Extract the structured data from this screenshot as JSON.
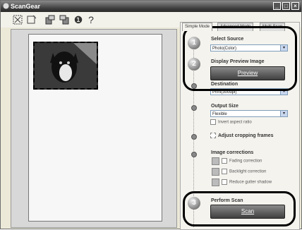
{
  "window": {
    "title": "ScanGear",
    "minimize": "_",
    "maximize": "□",
    "close": "×"
  },
  "toolbar": {
    "info_glyph": "❶",
    "help_glyph": "?"
  },
  "tabs": [
    "Simple Mode",
    "Advanced Mode",
    "Multi-Scan"
  ],
  "steps": {
    "s1": {
      "num": "1",
      "label": "Select Source",
      "value": "Photo(Color)"
    },
    "s2": {
      "num": "2",
      "label": "Display Preview Image",
      "button": "Preview"
    },
    "destination": {
      "label": "Destination",
      "value": "Print(300dpi)"
    },
    "output": {
      "label": "Output Size",
      "value": "Flexible",
      "invert": "Invert aspect ratio"
    },
    "crop": {
      "label": "Adjust cropping frames"
    },
    "corrections": {
      "label": "Image corrections",
      "items": [
        "Fading correction",
        "Backlight correction",
        "Reduce gutter shadow"
      ]
    },
    "s3": {
      "num": "3",
      "label": "Perform Scan",
      "button": "Scan"
    }
  },
  "arrow": "▾"
}
